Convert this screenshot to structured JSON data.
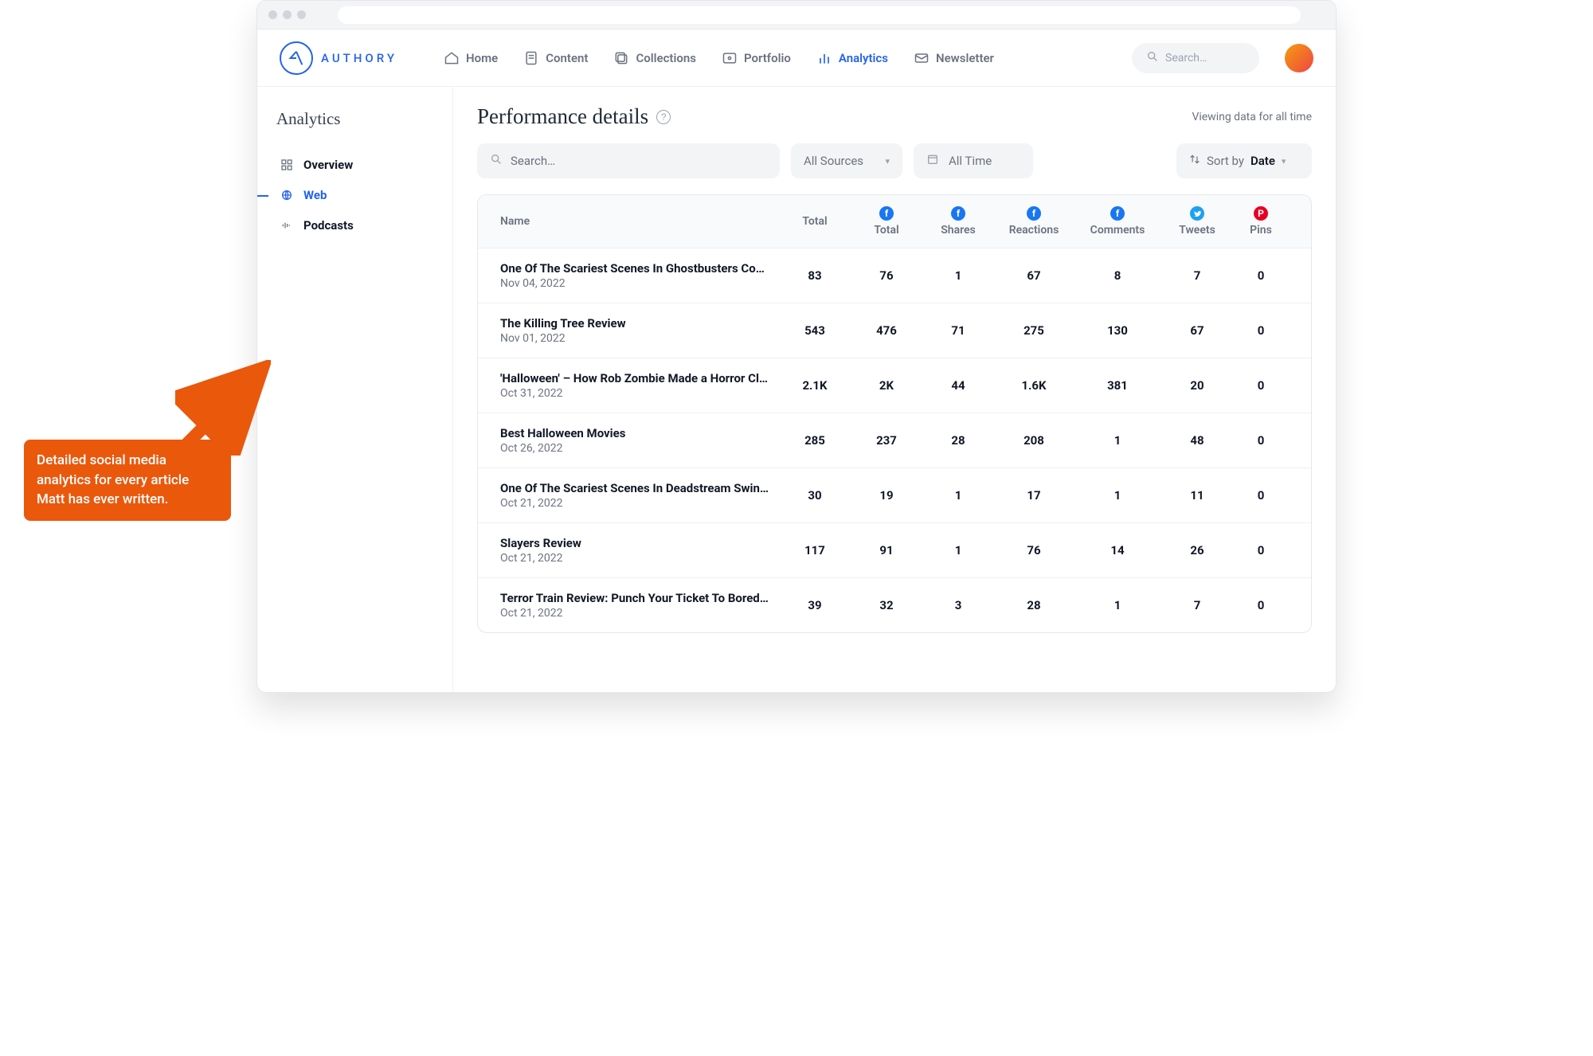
{
  "brand": "AUTHORY",
  "nav": {
    "home": "Home",
    "content": "Content",
    "collections": "Collections",
    "portfolio": "Portfolio",
    "analytics": "Analytics",
    "newsletter": "Newsletter"
  },
  "global_search_placeholder": "Search…",
  "sidebar": {
    "title": "Analytics",
    "overview": "Overview",
    "web": "Web",
    "podcasts": "Podcasts"
  },
  "page": {
    "title": "Performance details",
    "viewing_hint": "Viewing data for all time"
  },
  "filters": {
    "search_placeholder": "Search…",
    "sources": "All Sources",
    "time": "All Time",
    "sort_label": "Sort by",
    "sort_value": "Date"
  },
  "columns": {
    "name": "Name",
    "total": "Total",
    "fb_total": "Total",
    "shares": "Shares",
    "reactions": "Reactions",
    "comments": "Comments",
    "tweets": "Tweets",
    "pins": "Pins"
  },
  "rows": [
    {
      "title": "One Of The Scariest Scenes In Ghostbusters Comes …",
      "date": "Nov 04, 2022",
      "total": "83",
      "fb_total": "76",
      "shares": "1",
      "reactions": "67",
      "comments": "8",
      "tweets": "7",
      "pins": "0"
    },
    {
      "title": "The Killing Tree Review",
      "date": "Nov 01, 2022",
      "total": "543",
      "fb_total": "476",
      "shares": "71",
      "reactions": "275",
      "comments": "130",
      "tweets": "67",
      "pins": "0"
    },
    {
      "title": "'Halloween' – How Rob Zombie Made a Horror Classic…",
      "date": "Oct 31, 2022",
      "total": "2.1K",
      "fb_total": "2K",
      "shares": "44",
      "reactions": "1.6K",
      "comments": "381",
      "tweets": "20",
      "pins": "0"
    },
    {
      "title": "Best Halloween Movies",
      "date": "Oct 26, 2022",
      "total": "285",
      "fb_total": "237",
      "shares": "28",
      "reactions": "208",
      "comments": "1",
      "tweets": "48",
      "pins": "0"
    },
    {
      "title": "One Of The Scariest Scenes In Deadstream Swings In…",
      "date": "Oct 21, 2022",
      "total": "30",
      "fb_total": "19",
      "shares": "1",
      "reactions": "17",
      "comments": "1",
      "tweets": "11",
      "pins": "0"
    },
    {
      "title": "Slayers Review",
      "date": "Oct 21, 2022",
      "total": "117",
      "fb_total": "91",
      "shares": "1",
      "reactions": "76",
      "comments": "14",
      "tweets": "26",
      "pins": "0"
    },
    {
      "title": "Terror Train Review: Punch Your Ticket To Boredom […",
      "date": "Oct 21, 2022",
      "total": "39",
      "fb_total": "32",
      "shares": "3",
      "reactions": "28",
      "comments": "1",
      "tweets": "7",
      "pins": "0"
    }
  ],
  "callout": "Detailed social media analytics for every article Matt has ever written."
}
